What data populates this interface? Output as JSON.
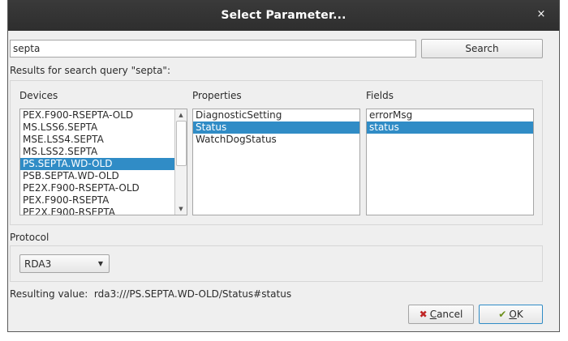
{
  "window": {
    "title": "Select Parameter...",
    "close_glyph": "×",
    "close_icon": "close-icon"
  },
  "search": {
    "value": "septa",
    "button_label": "Search",
    "results_label": "Results for search query \"septa\":"
  },
  "devices": {
    "label": "Devices",
    "items": [
      "PEX.F900-RSEPTA-OLD",
      "MS.LSS6.SEPTA",
      "MSE.LSS4.SEPTA",
      "MS.LSS2.SEPTA",
      "PS.SEPTA.WD-OLD",
      "PSB.SEPTA.WD-OLD",
      "PE2X.F900-RSEPTA-OLD",
      "PEX.F900-RSEPTA",
      "PE2X.F900-RSEPTA"
    ],
    "selected": "PS.SEPTA.WD-OLD",
    "scroll_up_glyph": "▲",
    "scroll_down_glyph": "▼"
  },
  "properties": {
    "label": "Properties",
    "items": [
      "DiagnosticSetting",
      "Status",
      "WatchDogStatus"
    ],
    "selected": "Status"
  },
  "fields": {
    "label": "Fields",
    "items": [
      "errorMsg",
      "status"
    ],
    "selected": "status"
  },
  "protocol": {
    "label": "Protocol",
    "value": "RDA3",
    "arrow_glyph": "▼"
  },
  "result": {
    "label": "Resulting value:",
    "value": "rda3:///PS.SEPTA.WD-OLD/Status#status"
  },
  "buttons": {
    "cancel_label_mnemonic": "C",
    "cancel_label_rest": "ancel",
    "cancel_icon_glyph": "✖",
    "ok_label_mnemonic": "O",
    "ok_label_rest": "K",
    "ok_icon_glyph": "✔"
  },
  "colors": {
    "selection": "#308cc6",
    "titlebar": "#2e2e2e",
    "dialog_background": "#efefef"
  }
}
